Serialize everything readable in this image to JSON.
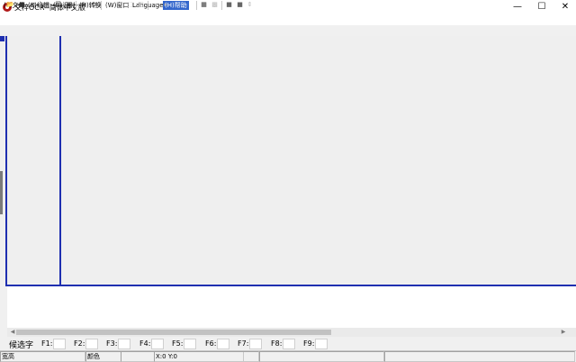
{
  "title_bar": {
    "title": "文梓OCR--简体中文版",
    "minimize_glyph": "—",
    "maximize_glyph": "☐",
    "close_glyph": "✕"
  },
  "menu": {
    "items": [
      {
        "label": "(F)文件"
      },
      {
        "label": "(E)编辑"
      },
      {
        "label": "(R)识别"
      },
      {
        "label": "(H)转换"
      },
      {
        "label": "(W)窗口"
      },
      {
        "label": "Language"
      },
      {
        "label": "(H)帮助"
      }
    ]
  },
  "toolbar": {
    "buttons": [
      {
        "icon": "open-folder-icon",
        "glyph": "📂"
      },
      {
        "icon": "save-icon",
        "glyph": "■"
      },
      {
        "icon": "scan-icon",
        "glyph": "≋"
      },
      {
        "icon": "cut-icon",
        "glyph": "✂"
      },
      {
        "icon": "copy-icon",
        "glyph": "❐"
      },
      {
        "icon": "paste-icon",
        "glyph": "▣"
      },
      {
        "icon": "zoom-in-icon",
        "glyph": "⊕"
      },
      {
        "icon": "zoom-out-icon",
        "glyph": "⊖"
      },
      {
        "icon": "select-region-icon",
        "glyph": "⬚"
      },
      {
        "icon": "select-column-icon",
        "glyph": "⬚"
      },
      {
        "icon": "select-table-icon",
        "glyph": "⬚"
      },
      {
        "icon": "recognize-icon",
        "glyph": "◧"
      },
      {
        "icon": "prev-icon",
        "glyph": "◂"
      },
      {
        "icon": "next-icon",
        "glyph": "▸"
      },
      {
        "icon": "window-icon",
        "glyph": "▦"
      },
      {
        "icon": "image-icon",
        "glyph": "▩"
      },
      {
        "icon": "block-icon",
        "glyph": "■"
      },
      {
        "icon": "block2-icon",
        "glyph": "■"
      },
      {
        "icon": "spin-icon",
        "glyph": "⇕"
      }
    ]
  },
  "candidate_bar": {
    "label": "候选字",
    "keys": [
      "F1:",
      "F2:",
      "F3:",
      "F4:",
      "F5:",
      "F6:",
      "F7:",
      "F8:",
      "F9:"
    ]
  },
  "status_bar": {
    "panel1": "宽高",
    "panel2": "颜色",
    "panel3": "X:0 Y:0"
  },
  "colors": {
    "accent_blue": "#1f2fb0",
    "menu_highlight": "#3366cc",
    "icon_red": "#b01818"
  }
}
